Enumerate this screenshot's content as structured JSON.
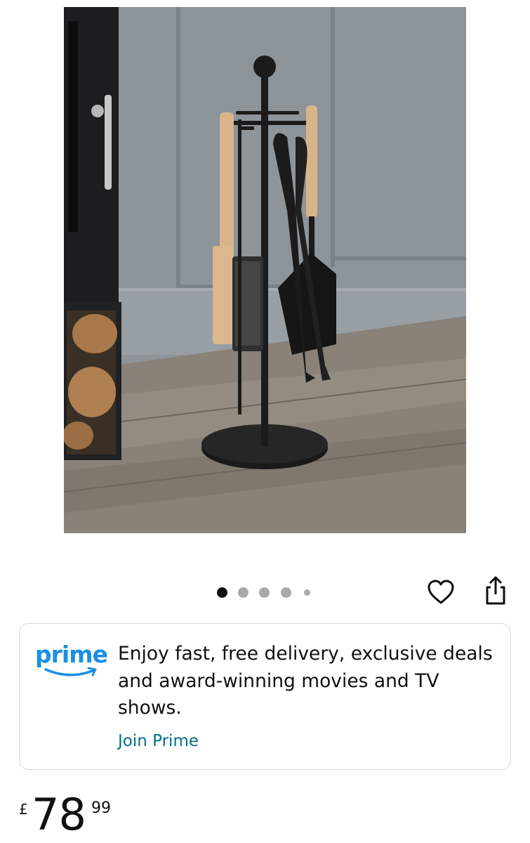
{
  "product": {
    "image_alt": "",
    "carousel": {
      "total": 5,
      "active_index": 0
    }
  },
  "actions": {
    "wishlist_icon": "heart-outline-icon",
    "share_icon": "share-icon"
  },
  "prime": {
    "logo_text": "prime",
    "message": "Enjoy fast, free delivery, exclusive deals and award-winning movies and TV shows.",
    "link_label": "Join Prime"
  },
  "price": {
    "symbol": "£",
    "whole": "78",
    "fraction": "99"
  },
  "colors": {
    "prime_blue": "#1a8fe3",
    "link_teal": "#007185",
    "text": "#0f1111",
    "card_border": "#d5d9d9"
  }
}
